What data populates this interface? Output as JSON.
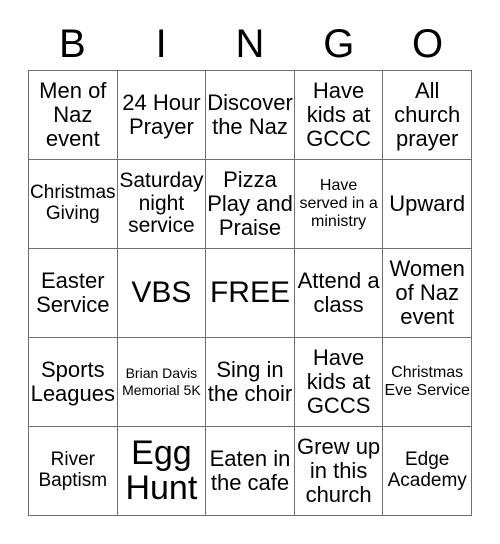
{
  "card": {
    "title": "BINGO",
    "header_letters": [
      "B",
      "I",
      "N",
      "G",
      "O"
    ],
    "grid_size": "5x5",
    "colors": {
      "background": "#ffffff",
      "text": "#000000",
      "grid_line": "#6f6f6f"
    }
  },
  "grid": {
    "rows": [
      {
        "cells": [
          {
            "text": "Men of Naz event",
            "size": "md"
          },
          {
            "text": "24 Hour Prayer",
            "size": "md"
          },
          {
            "text": "Discover the Naz",
            "size": "md"
          },
          {
            "text": "Have kids at GCCC",
            "size": "md"
          },
          {
            "text": "All church prayer",
            "size": "md"
          }
        ]
      },
      {
        "cells": [
          {
            "text": "Christmas Giving",
            "size": "sm"
          },
          {
            "text": "Saturday night service",
            "size": "md"
          },
          {
            "text": "Pizza Play and Praise",
            "size": "md"
          },
          {
            "text": "Have served in a ministry",
            "size": "xs"
          },
          {
            "text": "Upward",
            "size": "md"
          }
        ]
      },
      {
        "cells": [
          {
            "text": "Easter Service",
            "size": "md"
          },
          {
            "text": "VBS",
            "size": "lg"
          },
          {
            "text": "FREE",
            "size": "lg"
          },
          {
            "text": "Attend a class",
            "size": "md"
          },
          {
            "text": "Women of Naz event",
            "size": "md"
          }
        ]
      },
      {
        "cells": [
          {
            "text": "Sports Leagues",
            "size": "md"
          },
          {
            "text": "Brian Davis Memorial 5K",
            "size": "xxs"
          },
          {
            "text": "Sing in the choir",
            "size": "md"
          },
          {
            "text": "Have kids at GCCS",
            "size": "md"
          },
          {
            "text": "Christmas Eve Service",
            "size": "xs"
          }
        ]
      },
      {
        "cells": [
          {
            "text": "River Baptism",
            "size": "sm"
          },
          {
            "text": "Egg Hunt",
            "size": "xl"
          },
          {
            "text": "Eaten in the cafe",
            "size": "md"
          },
          {
            "text": "Grew up in this church",
            "size": "md"
          },
          {
            "text": "Edge Academy",
            "size": "sm"
          }
        ]
      }
    ]
  }
}
